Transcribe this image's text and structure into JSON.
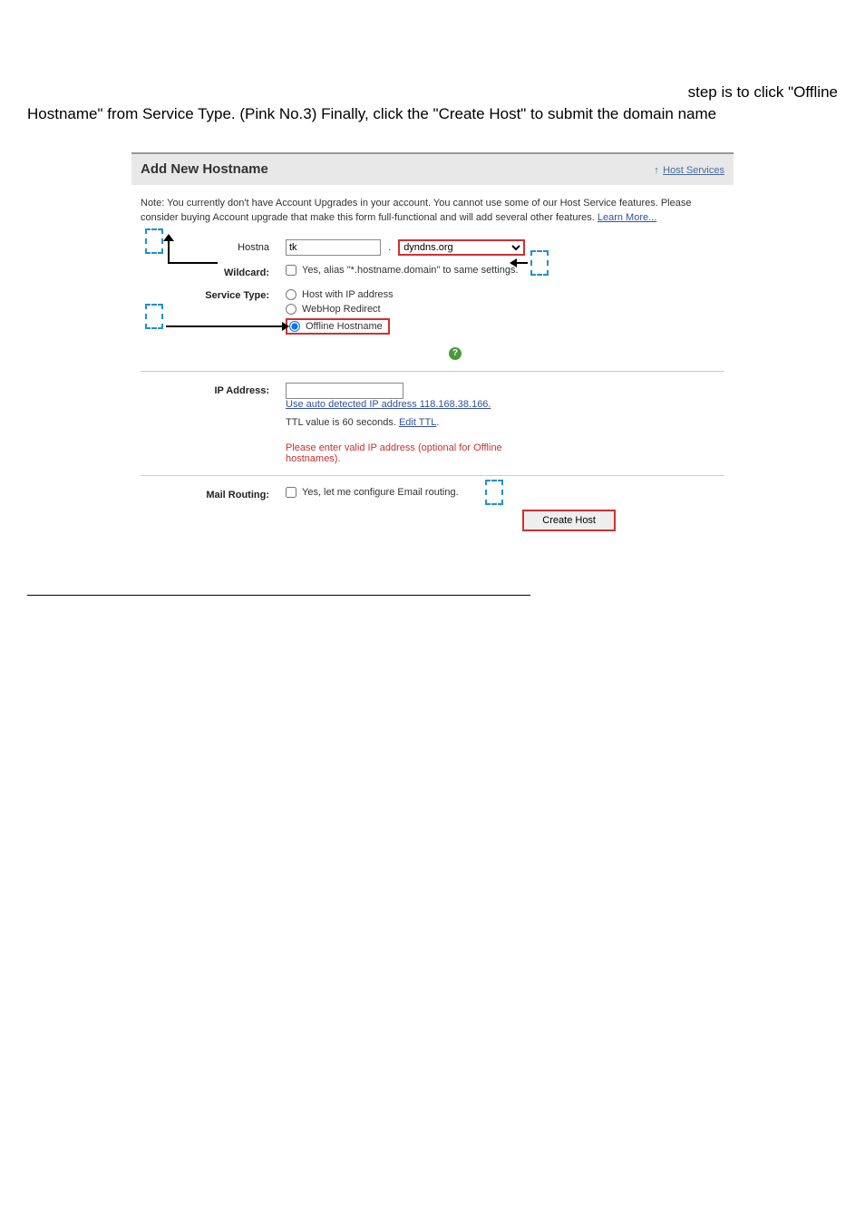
{
  "instruction": {
    "line1": "step is to click \"Offline",
    "line2": "Hostname\" from Service Type. (Pink No.3) Finally, click the \"Create Host\" to submit the domain name"
  },
  "header": {
    "title": "Add New Hostname",
    "host_services_link": "Host Services"
  },
  "note": {
    "text_part1": "Note: You currently don't have Account Upgrades in your account. You cannot use some of our Host Service features. Please consider buying Account upgrade that make this form full-functional and will add several other features. ",
    "learn_more": "Learn More..."
  },
  "form": {
    "hostname_label": "Hostna",
    "hostname_value": "tk",
    "domain_value": "dyndns.org",
    "wildcard_label": "Wildcard:",
    "wildcard_text": "Yes, alias \"*.hostname.domain\" to same settings.",
    "service_type_label": "Service Type:",
    "service_types": {
      "host_ip": "Host with IP address",
      "webhop": "WebHop Redirect",
      "offline": "Offline Hostname"
    },
    "ip_label": "IP Address:",
    "ip_value": "",
    "auto_ip_link": "Use auto detected IP address 118.168.38.166.",
    "ttl_text_pre": "TTL value is 60 seconds. ",
    "ttl_link": "Edit TTL",
    "ttl_text_post": ".",
    "ip_error": "Please enter valid IP address (optional for Offline hostnames).",
    "mail_label": "Mail Routing:",
    "mail_text": "Yes, let me configure Email routing.",
    "create_button": "Create Host"
  }
}
